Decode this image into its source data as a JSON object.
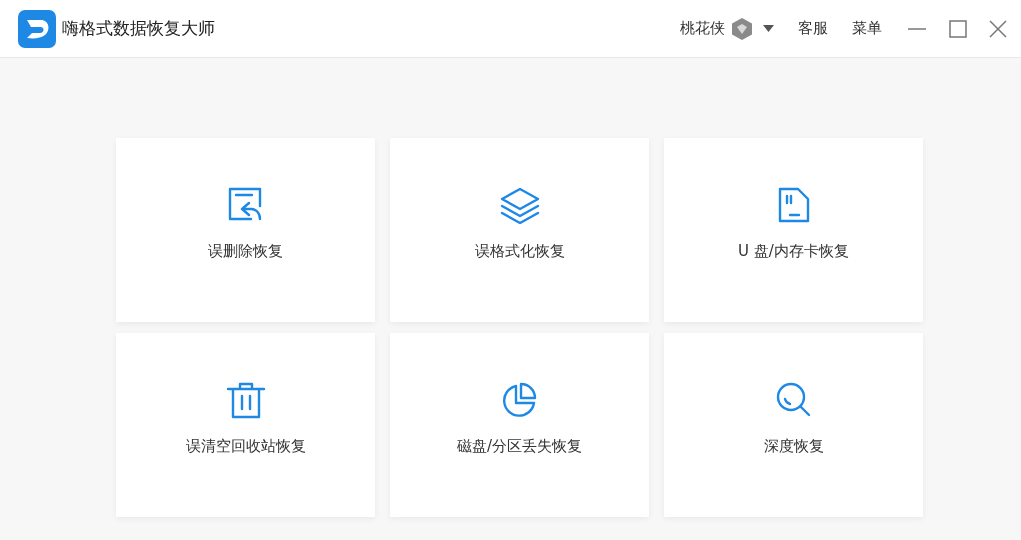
{
  "window": {
    "title": "嗨格式数据恢复大师"
  },
  "user": {
    "name": "桃花侠"
  },
  "header_links": [
    "客服",
    "菜单"
  ],
  "cards": [
    {
      "kind": "delete",
      "label": "误删除恢复"
    },
    {
      "kind": "format",
      "label": "误格式化恢复"
    },
    {
      "kind": "card",
      "label": "U 盘/内存卡恢复"
    },
    {
      "kind": "trash",
      "label": "误清空回收站恢复"
    },
    {
      "kind": "partition",
      "label": "磁盘/分区丢失恢复"
    },
    {
      "kind": "deep",
      "label": "深度恢复"
    }
  ]
}
